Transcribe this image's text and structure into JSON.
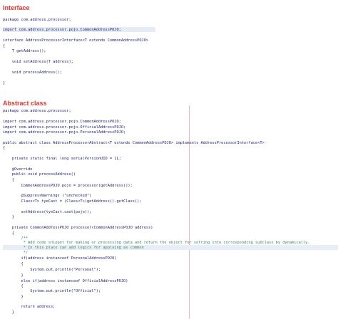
{
  "interface": {
    "heading": "Interface",
    "lines": [
      "package com.address.processor;",
      "",
      "import com.address.processor.pojo.CommonAddressPOJO;",
      "",
      "interface AddressProcessorInterface<T extends CommonAddressPOJO>",
      "{",
      "    T getAddress();",
      "",
      "    void setAddress(T address);",
      "",
      "    void processAddress();",
      "",
      "}"
    ]
  },
  "abstract": {
    "heading": "Abstract class",
    "lines": [
      "package com.address.processor;",
      "",
      "import com.address.processor.pojo.CommonAddressPOJO;",
      "import com.address.processor.pojo.OfficialAddressPOJO;",
      "import com.address.processor.pojo.PersonalAddressPOJO;",
      "",
      "public abstract class AddressProcessorAbstract<T extends CommonAddressPOJO> implements AddressProcessorInterface<T>",
      "{",
      "",
      "    private static final long serialVersionUID = 1L;",
      "",
      "    @Override",
      "    public void processAddress()",
      "    {",
      "        CommonAddressPOJO pojo = processor(getAddress());",
      "",
      "        @SuppressWarnings (\"unchecked\")",
      "        Class<T> tyeCast = (Class<T>)getAddress().getClass();",
      "",
      "        setAddress(tyeCast.cast(pojo));",
      "    }",
      "",
      "    private CommonAddressPOJO processor(CommonAddressPOJO address)",
      "    {",
      "        /**",
      "         * Add code snippet for making or processing data and return the object for setting into corresponding subclass by dynamically.",
      "         * In this place can add logics for applying as common",
      "         */",
      "        if(address instanceof PersonalAddressPOJO)",
      "        {",
      "            System.out.println(\"Personal\");",
      "        }",
      "        else if(address instanceof OfficialAddressPOJO)",
      "        {",
      "            System.out.println(\"Official\");",
      "        }",
      "",
      "        return address;",
      "    }"
    ]
  }
}
